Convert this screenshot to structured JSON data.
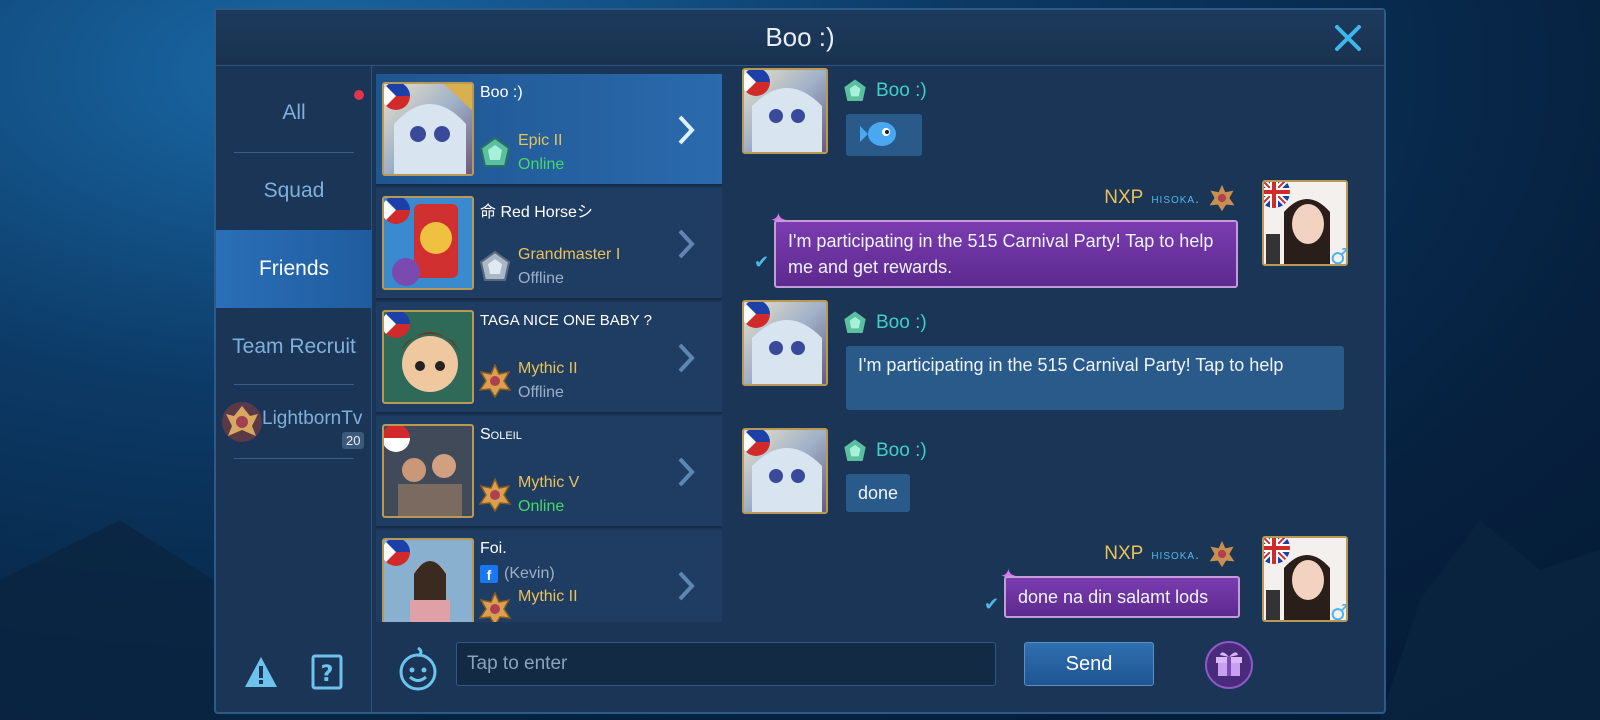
{
  "header": {
    "title": "Boo :)"
  },
  "categories": [
    {
      "label": "All",
      "has_notification": true
    },
    {
      "label": "Squad"
    },
    {
      "label": "Friends",
      "active": true
    },
    {
      "label": "Team Recruit"
    }
  ],
  "squad": {
    "name": "LightbornTv",
    "count": "20"
  },
  "friends": [
    {
      "name": "Boo :)",
      "rank": "Epic II",
      "status": "Online",
      "online": true,
      "flag": "philippines"
    },
    {
      "name": "命 Red Horseシ",
      "rank": "Grandmaster I",
      "status": "Offline",
      "online": false,
      "flag": "philippines"
    },
    {
      "name": "TAGA NICE ONE BABY ?",
      "rank": "Mythic II",
      "status": "Offline",
      "online": false,
      "flag": "philippines"
    },
    {
      "name": "Soleil",
      "rank": "Mythic V",
      "status": "Online",
      "online": true,
      "flag": "indonesia"
    },
    {
      "name": "Foi.",
      "fb_name": "(Kevin)",
      "rank": "Mythic II",
      "flag": "philippines"
    }
  ],
  "chat": {
    "messages": [
      {
        "sender": "Boo :)",
        "text": "",
        "sticker": "blue-fish-sticker"
      },
      {
        "sender": "NXP",
        "tag": "hisoka.",
        "self": true,
        "text": "I'm participating in the 515 Carnival Party! Tap to help me and get rewards."
      },
      {
        "sender": "Boo :)",
        "text": "I'm participating in the 515 Carnival Party! Tap to help"
      },
      {
        "sender": "Boo :)",
        "text": "done"
      },
      {
        "sender": "NXP",
        "tag": "hisoka.",
        "self": true,
        "text": "done na din salamt lods"
      }
    ]
  },
  "input": {
    "placeholder": "Tap to enter",
    "send_label": "Send"
  },
  "colors": {
    "panel": "#1b3556",
    "accent": "#2b6fb8",
    "online": "#47d66a",
    "rank": "#e9c25a",
    "bubble_self": "#7b3cb0"
  }
}
